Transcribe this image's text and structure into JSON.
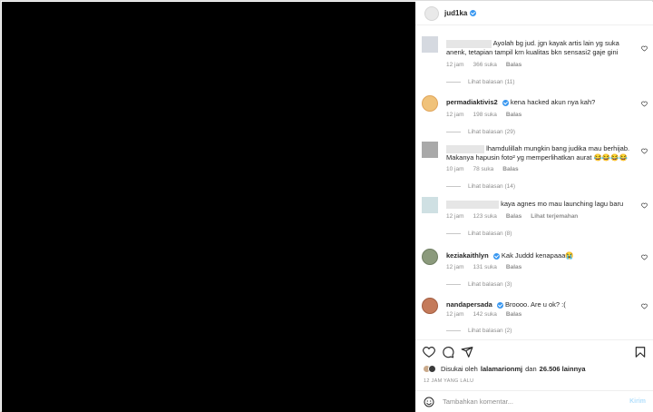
{
  "post": {
    "username": "jud1ka"
  },
  "comments": [
    {
      "username": "",
      "text": "Ayolah bg jud. jgn kayak artis lain yg suka anenk, tetapian tampil krn kualitas bkn sensasi2 gaje gini",
      "time": "12 jam",
      "likes": "366 suka",
      "reply": "Balas",
      "translate": "",
      "view_replies": "Lihat balasan (11)"
    },
    {
      "username": "permadiaktivis2",
      "text": "kena hacked akun nya kah?",
      "time": "12 jam",
      "likes": "198 suka",
      "reply": "Balas",
      "translate": "",
      "view_replies": "Lihat balasan (29)"
    },
    {
      "username": "",
      "text": "lhamdulillah mungkin bang judika mau berhijab. Makanya hapusin foto² yg memperlihatkan aurat 😂😂😂😂",
      "time": "10 jam",
      "likes": "78 suka",
      "reply": "Balas",
      "translate": "",
      "view_replies": "Lihat balasan (14)"
    },
    {
      "username": "",
      "text": "kaya agnes mo mau launching lagu baru",
      "time": "12 jam",
      "likes": "123 suka",
      "reply": "Balas",
      "translate": "Lihat terjemahan",
      "view_replies": "Lihat balasan (8)"
    },
    {
      "username": "keziakaithlyn",
      "text": "Kak Juddd kenapaaa😭",
      "time": "12 jam",
      "likes": "131 suka",
      "reply": "Balas",
      "translate": "",
      "view_replies": "Lihat balasan (3)"
    },
    {
      "username": "nandapersada",
      "text": "Broooo. Are u ok? :(",
      "time": "12 jam",
      "likes": "142 suka",
      "reply": "Balas",
      "translate": "",
      "view_replies": "Lihat balasan (2)"
    }
  ],
  "actions": {
    "like_icon": "heart-icon",
    "comment_icon": "comment-icon",
    "share_icon": "share-icon",
    "save_icon": "bookmark-icon"
  },
  "likes": {
    "prefix": "Disukai oleh",
    "user": "lalamarionmj",
    "middle": "dan",
    "count": "26.506 lainnya"
  },
  "time_ago": "12 JAM YANG LALU",
  "composer": {
    "placeholder": "Tambahkan komentar...",
    "post_label": "Kirim"
  },
  "colors": {
    "verified": "#3897f0",
    "muted": "#8e8e8e",
    "text": "#262626"
  }
}
